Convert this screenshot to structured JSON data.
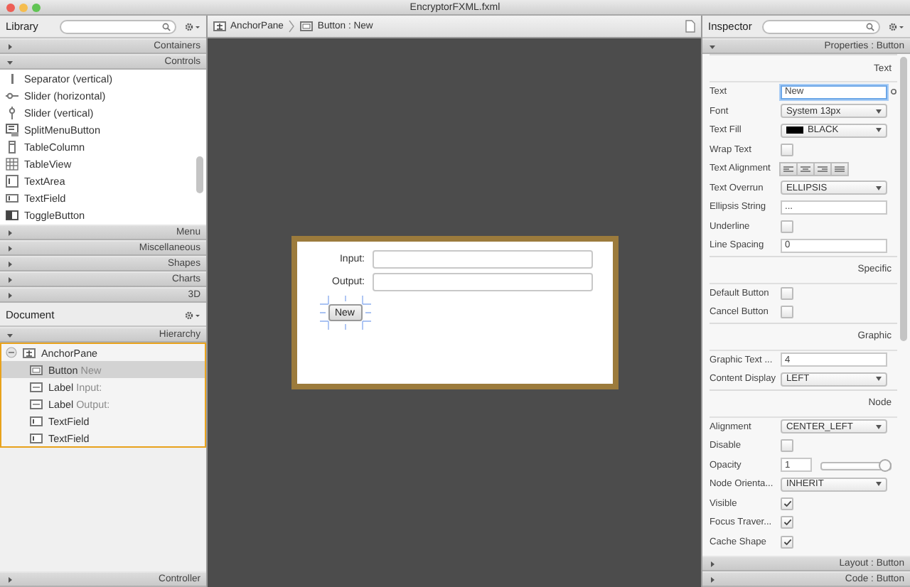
{
  "window": {
    "title": "EncryptorFXML.fxml"
  },
  "library": {
    "title": "Library",
    "sections_top": [
      {
        "label": "Containers",
        "expanded": false
      },
      {
        "label": "Controls",
        "expanded": true
      }
    ],
    "items": [
      {
        "label": "Separator  (vertical)"
      },
      {
        "label": "Slider  (horizontal)"
      },
      {
        "label": "Slider  (vertical)"
      },
      {
        "label": "SplitMenuButton"
      },
      {
        "label": "TableColumn"
      },
      {
        "label": "TableView"
      },
      {
        "label": "TextArea"
      },
      {
        "label": "TextField"
      },
      {
        "label": "ToggleButton"
      }
    ],
    "sections_bottom": [
      {
        "label": "Menu",
        "expanded": false
      },
      {
        "label": "Miscellaneous",
        "expanded": false
      },
      {
        "label": "Shapes",
        "expanded": false
      },
      {
        "label": "Charts",
        "expanded": false
      },
      {
        "label": "3D",
        "expanded": false
      }
    ]
  },
  "document": {
    "title": "Document",
    "section": {
      "label": "Hierarchy",
      "expanded": true
    },
    "tree": [
      {
        "type": "AnchorPane",
        "expanded": true,
        "selected": false,
        "children": [
          {
            "type": "Button",
            "text": "New",
            "selected": true
          },
          {
            "type": "Label",
            "text": "Input:",
            "selected": false
          },
          {
            "type": "Label",
            "text": "Output:",
            "selected": false
          },
          {
            "type": "TextField",
            "selected": false
          },
          {
            "type": "TextField",
            "selected": false
          }
        ]
      }
    ],
    "footer": {
      "label": "Controller",
      "expanded": false
    }
  },
  "breadcrumb": [
    {
      "label": "AnchorPane"
    },
    {
      "label": "Button : New"
    }
  ],
  "form": {
    "rows": [
      {
        "label": "Input:"
      },
      {
        "label": "Output:"
      }
    ],
    "button": {
      "label": "New",
      "selected": true
    }
  },
  "inspector": {
    "title": "Inspector",
    "section": {
      "label": "Properties : Button",
      "expanded": true
    },
    "groups": [
      {
        "title": "Text",
        "rows": [
          {
            "kind": "field",
            "label": "Text",
            "value": "New",
            "focused": true
          },
          {
            "kind": "combo",
            "label": "Font",
            "value": "System 13px"
          },
          {
            "kind": "combo",
            "label": "Text Fill",
            "value": "BLACK",
            "color": "#000000"
          },
          {
            "kind": "checkbox",
            "label": "Wrap Text",
            "checked": false
          },
          {
            "kind": "segments",
            "label": "Text Alignment"
          },
          {
            "kind": "combo",
            "label": "Text Overrun",
            "value": "ELLIPSIS"
          },
          {
            "kind": "field",
            "label": "Ellipsis String",
            "value": "...",
            "focused": false
          },
          {
            "kind": "checkbox",
            "label": "Underline",
            "checked": false
          },
          {
            "kind": "field",
            "label": "Line Spacing",
            "value": "0",
            "focused": false
          }
        ]
      },
      {
        "title": "Specific",
        "rows": [
          {
            "kind": "checkbox",
            "label": "Default Button",
            "checked": false
          },
          {
            "kind": "checkbox",
            "label": "Cancel Button",
            "checked": false
          }
        ]
      },
      {
        "title": "Graphic",
        "rows": [
          {
            "kind": "field",
            "label": "Graphic Text ...",
            "value": "4",
            "focused": false
          },
          {
            "kind": "combo",
            "label": "Content Display",
            "value": "LEFT"
          }
        ]
      },
      {
        "title": "Node",
        "rows": [
          {
            "kind": "combo",
            "label": "Alignment",
            "value": "CENTER_LEFT"
          },
          {
            "kind": "checkbox",
            "label": "Disable",
            "checked": false
          },
          {
            "kind": "slider",
            "label": "Opacity",
            "value": "1",
            "level": 1
          },
          {
            "kind": "combo",
            "label": "Node Orienta...",
            "value": "INHERIT"
          },
          {
            "kind": "checkbox",
            "label": "Visible",
            "checked": true
          },
          {
            "kind": "checkbox",
            "label": "Focus Traver...",
            "checked": true
          },
          {
            "kind": "checkbox",
            "label": "Cache Shape",
            "checked": true
          }
        ]
      }
    ],
    "footers": [
      {
        "label": "Layout : Button",
        "expanded": false
      },
      {
        "label": "Code : Button",
        "expanded": false
      }
    ]
  }
}
